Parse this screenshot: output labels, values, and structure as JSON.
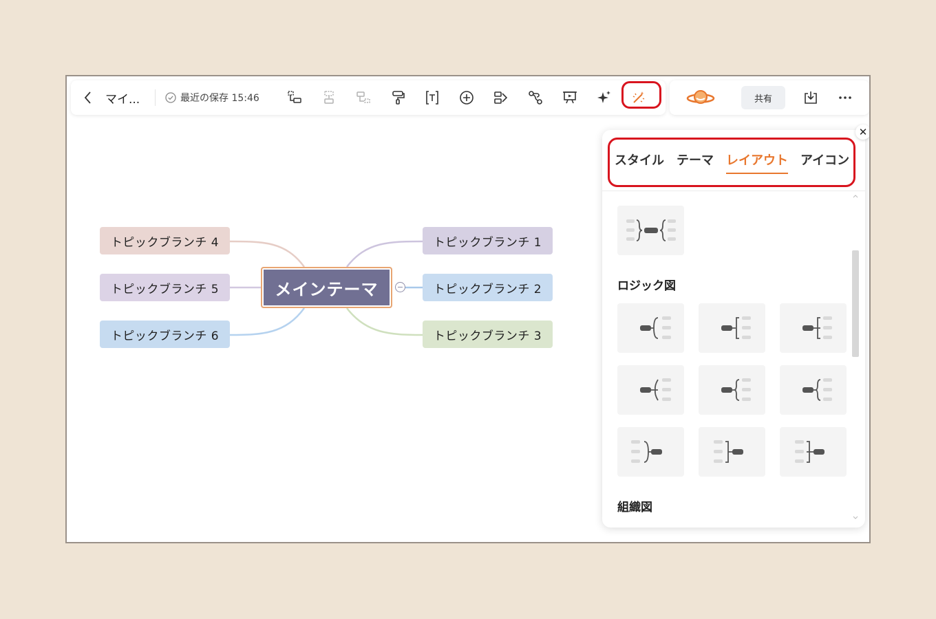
{
  "toolbar": {
    "title": "マイ...",
    "save_status": "最近の保存 15:46",
    "share_label": "共有",
    "tools": [
      "subtopic-icon",
      "sibling-topic-icon",
      "parent-topic-icon",
      "format-painter-icon",
      "text-icon",
      "insert-icon",
      "relationship-icon",
      "link-icon",
      "presentation-icon",
      "ai-sparkle-icon",
      "magic-wand-icon"
    ]
  },
  "mindmap": {
    "central": "メインテーマ",
    "branches": {
      "b1": "トピックブランチ 1",
      "b2": "トピックブランチ 2",
      "b3": "トピックブランチ 3",
      "b4": "トピックブランチ 4",
      "b5": "トピックブランチ 5",
      "b6": "トピックブランチ 6"
    },
    "colors": {
      "central": "#717093",
      "b1": "#d6d0e3",
      "b2": "#c8dcf1",
      "b3": "#dbe6ce",
      "b4": "#ead6d2",
      "b5": "#dcd3e6",
      "b6": "#c6dbf0"
    }
  },
  "panel": {
    "tabs": [
      "スタイル",
      "テーマ",
      "レイアウト",
      "アイコン"
    ],
    "active_tab": "レイアウト",
    "sections": {
      "logic": "ロジック図",
      "org": "組織図"
    }
  },
  "colors": {
    "accent": "#e8772e",
    "highlight": "#d8141e",
    "background": "#efe4d5"
  }
}
